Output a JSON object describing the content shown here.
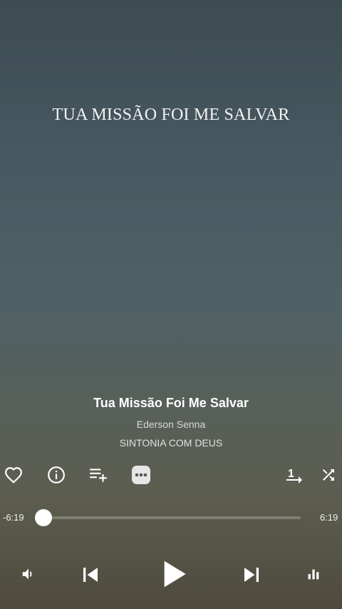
{
  "lyrics": {
    "current_line": "TUA MISSÃO FOI ME SALVAR"
  },
  "track": {
    "title": "Tua Missão Foi Me Salvar",
    "artist": "Ederson Senna",
    "album": "SINTONIA COM DEUS"
  },
  "actions": {
    "favorite_icon": "heart-outline-icon",
    "info_icon": "info-icon",
    "add_to_queue_icon": "playlist-add-icon",
    "more_icon": "more-horizontal-icon",
    "repeat_icon": "repeat-one-icon",
    "shuffle_icon": "shuffle-icon"
  },
  "progress": {
    "remaining": "-6:19",
    "duration": "6:19",
    "fraction": 0.0
  },
  "controls": {
    "volume_icon": "volume-icon",
    "previous_icon": "skip-previous-icon",
    "play_icon": "play-icon",
    "next_icon": "skip-next-icon",
    "equalizer_icon": "equalizer-icon"
  }
}
